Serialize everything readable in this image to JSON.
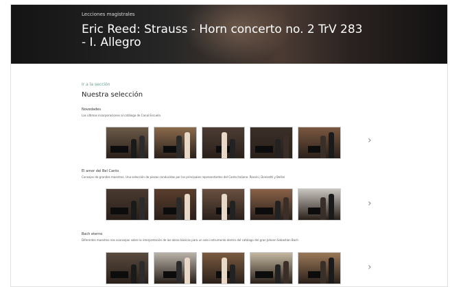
{
  "hero": {
    "breadcrumb": "Lecciones magistrales",
    "title": "Eric Reed: Strauss - Horn concerto no. 2 TrV 283 - I. Allegro"
  },
  "main": {
    "back_link": "Ir a la sección",
    "section_title": "Nuestra selección",
    "next_icon_glyph": "›"
  },
  "categories": [
    {
      "name": "Novedades",
      "description": "Las últimas incorporaciones al catálogo de Canal Escuela",
      "thumbnails": [
        {
          "bg": "#6b5a48"
        },
        {
          "bg": "#8a6a4c"
        },
        {
          "bg": "#4c3d33"
        },
        {
          "bg": "#3a3028"
        },
        {
          "bg": "#7a5840"
        }
      ]
    },
    {
      "name": "El amor del Bel Canto",
      "description": "Consejos de grandes maestros. Una selección de piezas conducidas por los principales representantes del Canto italiano: Rossini, Donizetti y Bellini",
      "thumbnails": [
        {
          "bg": "#4a3a30"
        },
        {
          "bg": "#5a3e2c"
        },
        {
          "bg": "#6a5040"
        },
        {
          "bg": "#8a6248"
        },
        {
          "bg": "#c8c4be"
        }
      ]
    },
    {
      "name": "Bach eterno",
      "description": "Diferentes maestros nos aconsejan sobre la interpretación de las obras básicas para un solo instrumento dentro del catálogo del gran Johann Sebastian Bach",
      "thumbnails": [
        {
          "bg": "#5a4a3e"
        },
        {
          "bg": "#b8b2a8"
        },
        {
          "bg": "#7a5a40"
        },
        {
          "bg": "#c4b8a0"
        },
        {
          "bg": "#9a7858"
        }
      ]
    }
  ]
}
